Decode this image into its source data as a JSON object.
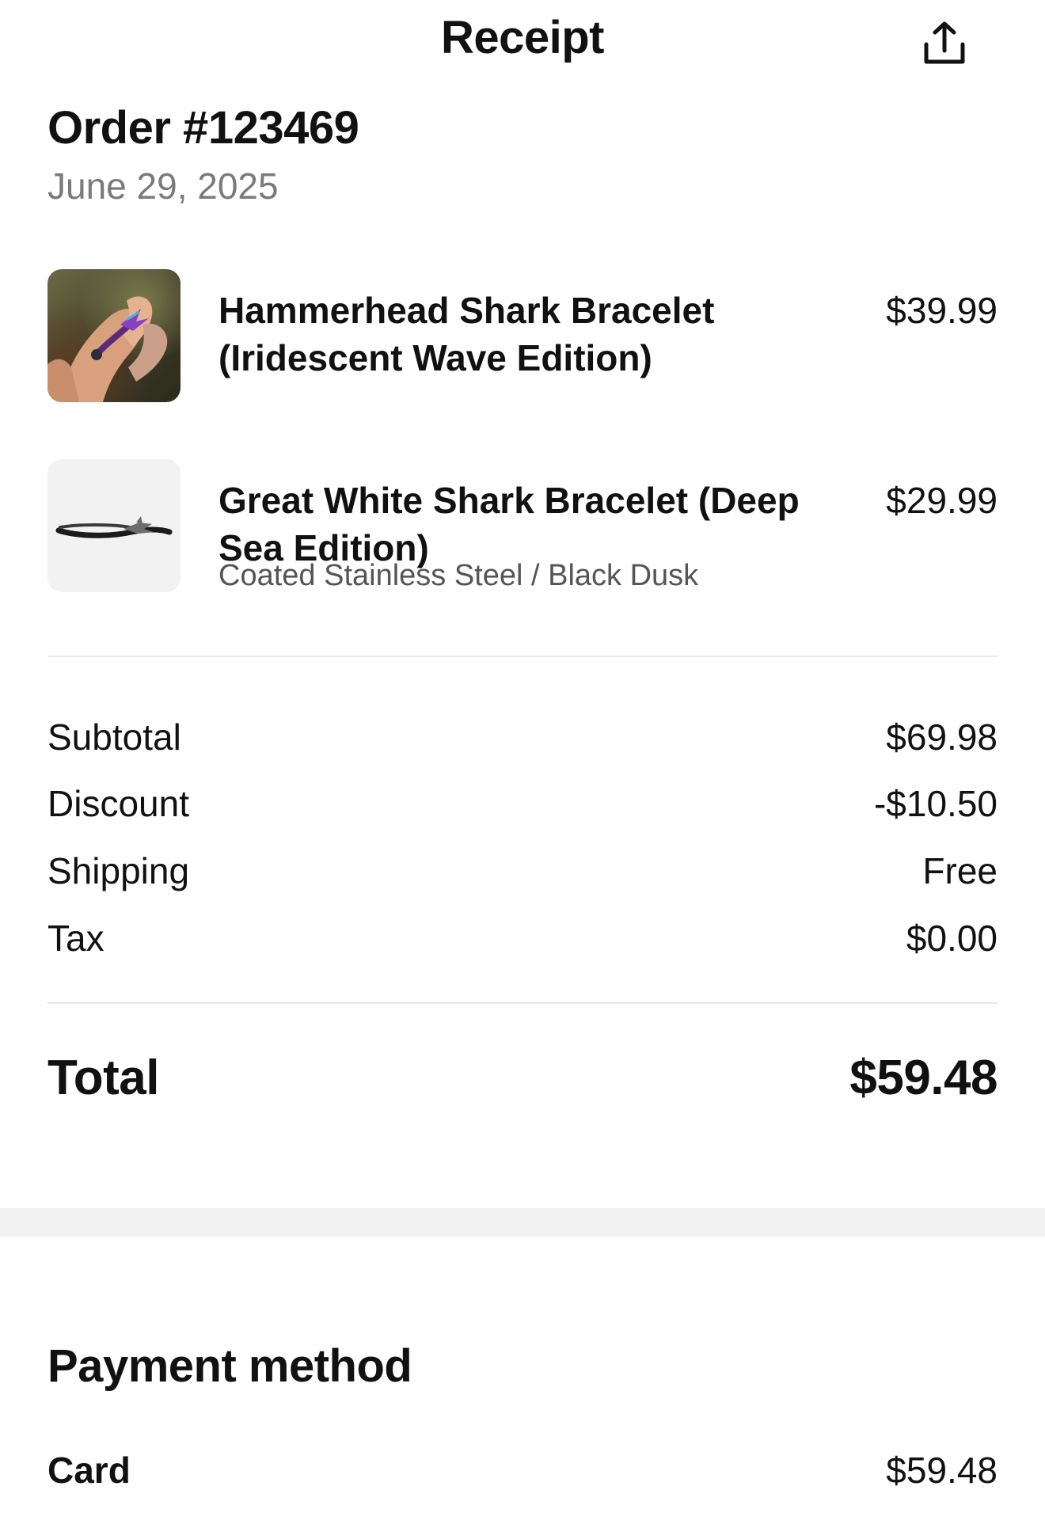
{
  "header": {
    "title": "Receipt",
    "share_icon": "share-upload-icon"
  },
  "order": {
    "title": "Order #123469",
    "date": "June 29, 2025"
  },
  "items": [
    {
      "name_line1": "Hammerhead Shark Bracelet",
      "name_line2": "(Iridescent Wave Edition)",
      "variant": "",
      "price": "$39.99"
    },
    {
      "name_line1": "Great White Shark Bracelet (Deep",
      "name_line2": "Sea Edition)",
      "variant": "Coated Stainless Steel / Black Dusk",
      "price": "$29.99"
    }
  ],
  "summary": {
    "subtotal_label": "Subtotal",
    "subtotal_value": "$69.98",
    "discount_label": "Discount",
    "discount_value": "-$10.50",
    "shipping_label": "Shipping",
    "shipping_value": "Free",
    "tax_label": "Tax",
    "tax_value": "$0.00",
    "total_label": "Total",
    "total_value": "$59.48"
  },
  "payment": {
    "title": "Payment method",
    "method_label": "Card",
    "method_value": "$59.48"
  },
  "colors": {
    "text": "#111111",
    "muted": "#7a7a7a",
    "divider": "#e8e8e8",
    "section_gap": "#f1f1f1"
  }
}
